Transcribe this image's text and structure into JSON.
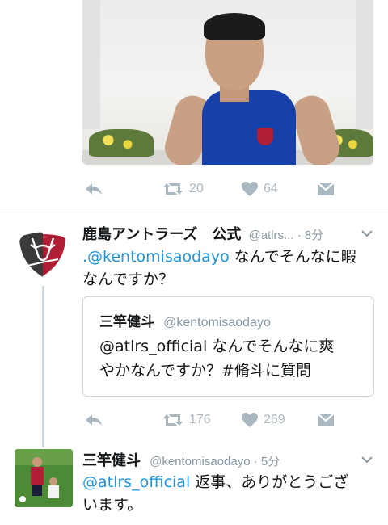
{
  "top_tweet": {
    "retweets": "20",
    "likes": "64"
  },
  "tweet1": {
    "display_name": "鹿島アントラーズ　公式",
    "handle_time": "@atlrs... · 8分",
    "mention": ".@kentomisaodayo",
    "text_line1": " なんでそんなに暇",
    "text_line2": "なんですか？",
    "retweets": "176",
    "likes": "269"
  },
  "quoted": {
    "display_name": "三竿健斗",
    "handle": "@kentomisaodayo",
    "line1_mention": "@atlrs_official",
    "line1_text": " なんでそんなに爽",
    "line2": "やかなんですか？#脩斗に質問"
  },
  "tweet2": {
    "display_name": "三竿健斗",
    "handle_time": "@kentomisaodayo · 5分",
    "mention": "@atlrs_official",
    "line1_text": " 返事、ありがとうござ",
    "line2": "います。"
  },
  "colors": {
    "mention_blue": "#1b95e0",
    "icon_gray": "#aab8c2",
    "divider": "#e1e8ed",
    "brand_red": "#b01e35"
  },
  "icons": [
    "reply-icon",
    "retweet-icon",
    "heart-icon",
    "dm-icon",
    "chevron-down-icon"
  ]
}
